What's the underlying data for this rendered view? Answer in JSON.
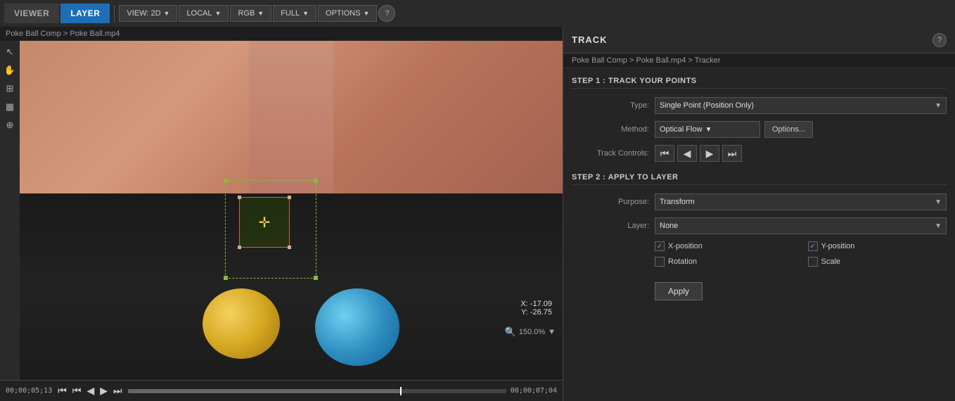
{
  "topbar": {
    "viewer_tab": "VIEWER",
    "layer_tab": "LAYER",
    "view_label": "VIEW: 2D",
    "local_label": "LOCAL",
    "rgb_label": "RGB",
    "full_label": "FULL",
    "options_label": "OPTIONS",
    "help_symbol": "?"
  },
  "viewer": {
    "breadcrumb": "Poke Ball Comp > Poke Ball.mp4",
    "coords_x_label": "X:",
    "coords_x_value": "-17.09",
    "coords_y_label": "Y:",
    "coords_y_value": "-26.75",
    "zoom_value": "150.0%",
    "timeline_start": "00;00;05;13",
    "timeline_end": "00;00;07;04"
  },
  "track_panel": {
    "title": "TRACK",
    "help_symbol": "?",
    "breadcrumb": "Poke Ball Comp > Poke Ball.mp4 > Tracker",
    "step1_header": "STEP 1 : TRACK YOUR POINTS",
    "type_label": "Type:",
    "type_value": "Single Point (Position Only)",
    "method_label": "Method:",
    "method_value": "Optical Flow",
    "options_label": "Options...",
    "track_controls_label": "Track Controls:",
    "step2_header": "STEP 2 : APPLY TO LAYER",
    "purpose_label": "Purpose:",
    "purpose_value": "Transform",
    "layer_label": "Layer:",
    "layer_value": "None",
    "x_position_label": "X-position",
    "y_position_label": "Y-position",
    "rotation_label": "Rotation",
    "scale_label": "Scale",
    "apply_label": "Apply",
    "x_checked": true,
    "y_checked": true,
    "rotation_checked": false,
    "scale_checked": false
  },
  "playback": {
    "rewind_icon": "⏮",
    "step_back_icon": "◀",
    "play_icon": "▶",
    "step_fwd_icon": "⏭"
  }
}
